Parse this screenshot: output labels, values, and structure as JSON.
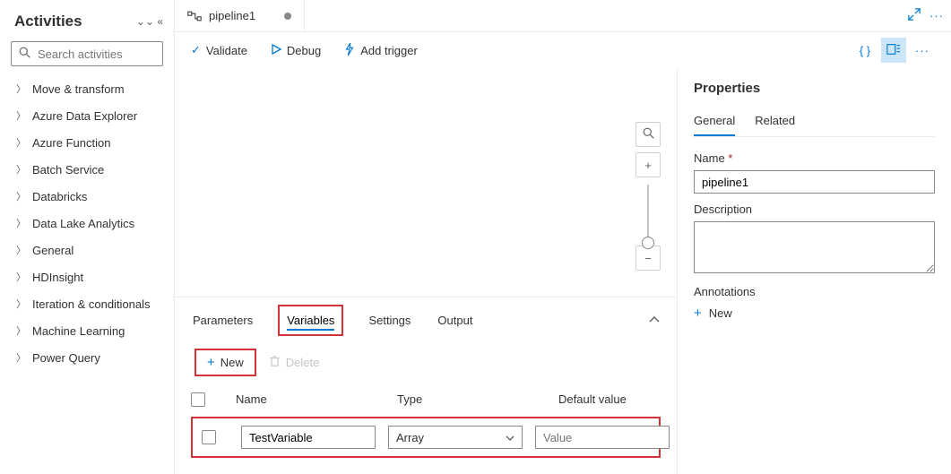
{
  "tab": {
    "title": "pipeline1"
  },
  "sidebar": {
    "title": "Activities",
    "search_placeholder": "Search activities",
    "categories": [
      "Move & transform",
      "Azure Data Explorer",
      "Azure Function",
      "Batch Service",
      "Databricks",
      "Data Lake Analytics",
      "General",
      "HDInsight",
      "Iteration & conditionals",
      "Machine Learning",
      "Power Query"
    ]
  },
  "toolbar": {
    "validate": "Validate",
    "debug": "Debug",
    "trigger": "Add trigger"
  },
  "bottom": {
    "tabs": [
      "Parameters",
      "Variables",
      "Settings",
      "Output"
    ],
    "active_index": 1,
    "new_label": "New",
    "delete_label": "Delete",
    "headers": {
      "name": "Name",
      "type": "Type",
      "default": "Default value"
    },
    "row": {
      "name": "TestVariable",
      "type": "Array",
      "default_placeholder": "Value"
    }
  },
  "props": {
    "title": "Properties",
    "tabs": [
      "General",
      "Related"
    ],
    "name_label": "Name",
    "name_value": "pipeline1",
    "desc_label": "Description",
    "ann_label": "Annotations",
    "ann_new": "New"
  }
}
